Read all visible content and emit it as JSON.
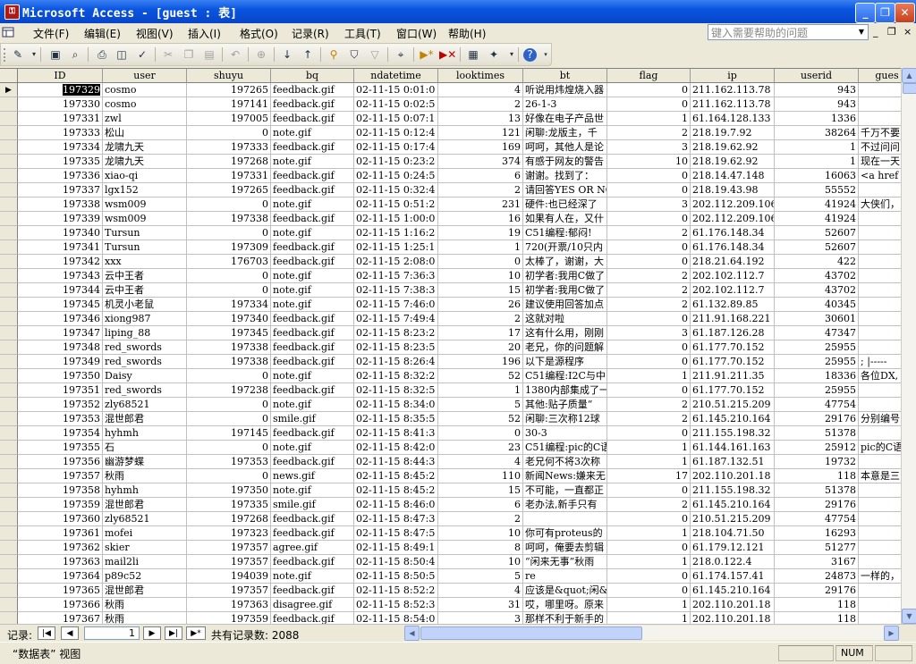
{
  "window": {
    "title": "Microsoft Access - [guest : 表]",
    "app_icon": "access-key-icon",
    "buttons": [
      "minimize",
      "restore",
      "close"
    ]
  },
  "menu": {
    "items": [
      "文件(F)",
      "编辑(E)",
      "视图(V)",
      "插入(I)",
      "格式(O)",
      "记录(R)",
      "工具(T)",
      "窗口(W)",
      "帮助(H)"
    ],
    "help_placeholder": "键入需要帮助的问题",
    "mdi_controls": [
      "_",
      "❐",
      "×"
    ]
  },
  "toolbar": {
    "icons": [
      "view-icon",
      "save-icon",
      "search-file-icon",
      "print-icon",
      "print-preview-icon",
      "spelling-icon",
      "cut-icon",
      "copy-icon",
      "paste-icon",
      "undo-icon",
      "insert-hyperlink-icon",
      "sort-ascending-icon",
      "sort-descending-icon",
      "filter-by-selection-icon",
      "filter-by-form-icon",
      "apply-filter-icon",
      "find-icon",
      "new-record-icon",
      "delete-record-icon",
      "database-window-icon",
      "new-object-icon",
      "help-icon"
    ]
  },
  "table": {
    "columns": [
      "ID",
      "user",
      "shuyu",
      "bq",
      "ndatetime",
      "looktimes",
      "bt",
      "flag",
      "ip",
      "userid",
      "gues"
    ],
    "rows": [
      [
        "197329",
        "cosmo",
        "197265",
        "feedback.gif",
        "02-11-15 0:01:0",
        "4",
        "听说用炜煌烧入器",
        "0",
        "211.162.113.78",
        "943",
        ""
      ],
      [
        "197330",
        "cosmo",
        "197141",
        "feedback.gif",
        "02-11-15 0:02:5",
        "2",
        "26-1-3",
        "0",
        "211.162.113.78",
        "943",
        ""
      ],
      [
        "197331",
        "zwl",
        "197005",
        "feedback.gif",
        "02-11-15 0:07:1",
        "13",
        "好像在电子产品世",
        "1",
        "61.164.128.133",
        "1336",
        ""
      ],
      [
        "197333",
        "松山",
        "0",
        "note.gif",
        "02-11-15 0:12:4",
        "121",
        "闲聊:龙版主，千",
        "2",
        "218.19.7.92",
        "38264",
        "千万不要"
      ],
      [
        "197334",
        "龙啸九天",
        "197333",
        "feedback.gif",
        "02-11-15 0:17:4",
        "169",
        "呵呵，其他人是论",
        "3",
        "218.19.62.92",
        "1",
        "不过问问"
      ],
      [
        "197335",
        "龙啸九天",
        "197268",
        "note.gif",
        "02-11-15 0:23:2",
        "374",
        "有感于网友的警告",
        "10",
        "218.19.62.92",
        "1",
        "现在一天"
      ],
      [
        "197336",
        "xiao-qi",
        "197331",
        "feedback.gif",
        "02-11-15 0:24:5",
        "6",
        "谢谢。找到了：",
        "0",
        "218.14.47.148",
        "16063",
        "<a href"
      ],
      [
        "197337",
        "lgx152",
        "197265",
        "feedback.gif",
        "02-11-15 0:32:4",
        "2",
        "请回答YES OR NO",
        "0",
        "218.19.43.98",
        "55552",
        ""
      ],
      [
        "197338",
        "wsm009",
        "0",
        "note.gif",
        "02-11-15 0:51:2",
        "231",
        "硬件:也已经深了",
        "3",
        "202.112.209.106",
        "41924",
        "大侠们，"
      ],
      [
        "197339",
        "wsm009",
        "197338",
        "feedback.gif",
        "02-11-15 1:00:0",
        "16",
        "如果有人在，又什",
        "0",
        "202.112.209.106",
        "41924",
        ""
      ],
      [
        "197340",
        "Tursun",
        "0",
        "note.gif",
        "02-11-15 1:16:2",
        "19",
        "C51编程:郁闷!",
        "2",
        "61.176.148.34",
        "52607",
        ""
      ],
      [
        "197341",
        "Tursun",
        "197309",
        "feedback.gif",
        "02-11-15 1:25:1",
        "1",
        "720(开票/10只内",
        "0",
        "61.176.148.34",
        "52607",
        ""
      ],
      [
        "197342",
        "xxx",
        "176703",
        "feedback.gif",
        "02-11-15 2:08:0",
        "0",
        "太棒了，谢谢，大",
        "0",
        "218.21.64.192",
        "422",
        ""
      ],
      [
        "197343",
        "云中王者",
        "0",
        "note.gif",
        "02-11-15 7:36:3",
        "10",
        "初学者:我用C做了",
        "2",
        "202.102.112.7",
        "43702",
        ""
      ],
      [
        "197344",
        "云中王者",
        "0",
        "note.gif",
        "02-11-15 7:38:3",
        "15",
        "初学者:我用C做了",
        "2",
        "202.102.112.7",
        "43702",
        ""
      ],
      [
        "197345",
        "机灵小老鼠",
        "197334",
        "note.gif",
        "02-11-15 7:46:0",
        "26",
        "建议使用回答加点",
        "2",
        "61.132.89.85",
        "40345",
        ""
      ],
      [
        "197346",
        "xiong987",
        "197340",
        "feedback.gif",
        "02-11-15 7:49:4",
        "2",
        "这就对啦",
        "0",
        "211.91.168.221",
        "30601",
        ""
      ],
      [
        "197347",
        "liping_88",
        "197345",
        "feedback.gif",
        "02-11-15 8:23:2",
        "17",
        "这有什么用，刚刚",
        "3",
        "61.187.126.28",
        "47347",
        ""
      ],
      [
        "197348",
        "red_swords",
        "197338",
        "feedback.gif",
        "02-11-15 8:23:5",
        "20",
        "老兄，你的问题解",
        "0",
        "61.177.70.152",
        "25955",
        ""
      ],
      [
        "197349",
        "red_swords",
        "197338",
        "feedback.gif",
        "02-11-15 8:26:4",
        "196",
        "以下是源程序",
        "0",
        "61.177.70.152",
        "25955",
        "; |-----"
      ],
      [
        "197350",
        "Daisy",
        "0",
        "note.gif",
        "02-11-15 8:32:2",
        "52",
        "C51编程:I2C与中",
        "1",
        "211.91.211.35",
        "18336",
        "各位DX,"
      ],
      [
        "197351",
        "red_swords",
        "197238",
        "feedback.gif",
        "02-11-15 8:32:5",
        "1",
        "1380内部集成了一",
        "0",
        "61.177.70.152",
        "25955",
        ""
      ],
      [
        "197352",
        "zly68521",
        "0",
        "note.gif",
        "02-11-15 8:34:0",
        "5",
        "其他:贴子质量“",
        "2",
        "210.51.215.209",
        "47754",
        ""
      ],
      [
        "197353",
        "混世郎君",
        "0",
        "smile.gif",
        "02-11-15 8:35:5",
        "52",
        "闲聊:三次称12球",
        "2",
        "61.145.210.164",
        "29176",
        "分别编号"
      ],
      [
        "197354",
        "hyhmh",
        "197145",
        "feedback.gif",
        "02-11-15 8:41:3",
        "0",
        "30-3",
        "0",
        "211.155.198.32",
        "51378",
        ""
      ],
      [
        "197355",
        "石",
        "0",
        "note.gif",
        "02-11-15 8:42:0",
        "23",
        "C51编程:pic的C语",
        "1",
        "61.144.161.163",
        "25912",
        "pic的C语"
      ],
      [
        "197356",
        "幽游梦蝶",
        "197353",
        "feedback.gif",
        "02-11-15 8:44:3",
        "4",
        "老兄何不将3次称",
        "1",
        "61.187.132.51",
        "19732",
        ""
      ],
      [
        "197357",
        "秋雨",
        "0",
        "news.gif",
        "02-11-15 8:45:2",
        "110",
        "新闻News:嫌来无",
        "17",
        "202.110.201.18",
        "118",
        "本意是三"
      ],
      [
        "197358",
        "hyhmh",
        "197350",
        "note.gif",
        "02-11-15 8:45:2",
        "15",
        "不可能，一直都正",
        "0",
        "211.155.198.32",
        "51378",
        ""
      ],
      [
        "197359",
        "混世郎君",
        "197335",
        "smile.gif",
        "02-11-15 8:46:0",
        "6",
        "老办法,新手只有",
        "2",
        "61.145.210.164",
        "29176",
        ""
      ],
      [
        "197360",
        "zly68521",
        "197268",
        "feedback.gif",
        "02-11-15 8:47:3",
        "2",
        "",
        "0",
        "210.51.215.209",
        "47754",
        ""
      ],
      [
        "197361",
        "mofei",
        "197323",
        "feedback.gif",
        "02-11-15 8:47:5",
        "10",
        "你可有proteus的",
        "1",
        "218.104.71.50",
        "16293",
        ""
      ],
      [
        "197362",
        "skier",
        "197357",
        "agree.gif",
        "02-11-15 8:49:1",
        "8",
        "呵呵，俺要去剪辑",
        "0",
        "61.179.12.121",
        "51277",
        ""
      ],
      [
        "197363",
        "mail2li",
        "197357",
        "feedback.gif",
        "02-11-15 8:50:4",
        "10",
        "“闲来无事”秋雨",
        "1",
        "218.0.122.4",
        "3167",
        ""
      ],
      [
        "197364",
        "p89c52",
        "194039",
        "note.gif",
        "02-11-15 8:50:5",
        "5",
        "re",
        "0",
        "61.174.157.41",
        "24873",
        "一样的，"
      ],
      [
        "197365",
        "混世郎君",
        "197357",
        "feedback.gif",
        "02-11-15 8:52:2",
        "4",
        "应该是&quot;闲&",
        "0",
        "61.145.210.164",
        "29176",
        ""
      ],
      [
        "197366",
        "秋雨",
        "197363",
        "disagree.gif",
        "02-11-15 8:52:3",
        "31",
        "哎，哪里呀。原来",
        "1",
        "202.110.201.18",
        "118",
        ""
      ],
      [
        "197367",
        "秋雨",
        "197359",
        "feedback.gif",
        "02-11-15 8:54:0",
        "3",
        "那样不利于新手的",
        "1",
        "202.110.201.18",
        "118",
        ""
      ]
    ],
    "current_row_marker": "▶"
  },
  "navigation": {
    "label": "记录:",
    "current_record": "1",
    "total_text": "共有记录数: 2088",
    "buttons": [
      "|◀",
      "◀",
      "▶",
      "▶|",
      "▶*"
    ]
  },
  "status": {
    "view_text": "“数据表” 视图",
    "num_lock": "NUM"
  }
}
